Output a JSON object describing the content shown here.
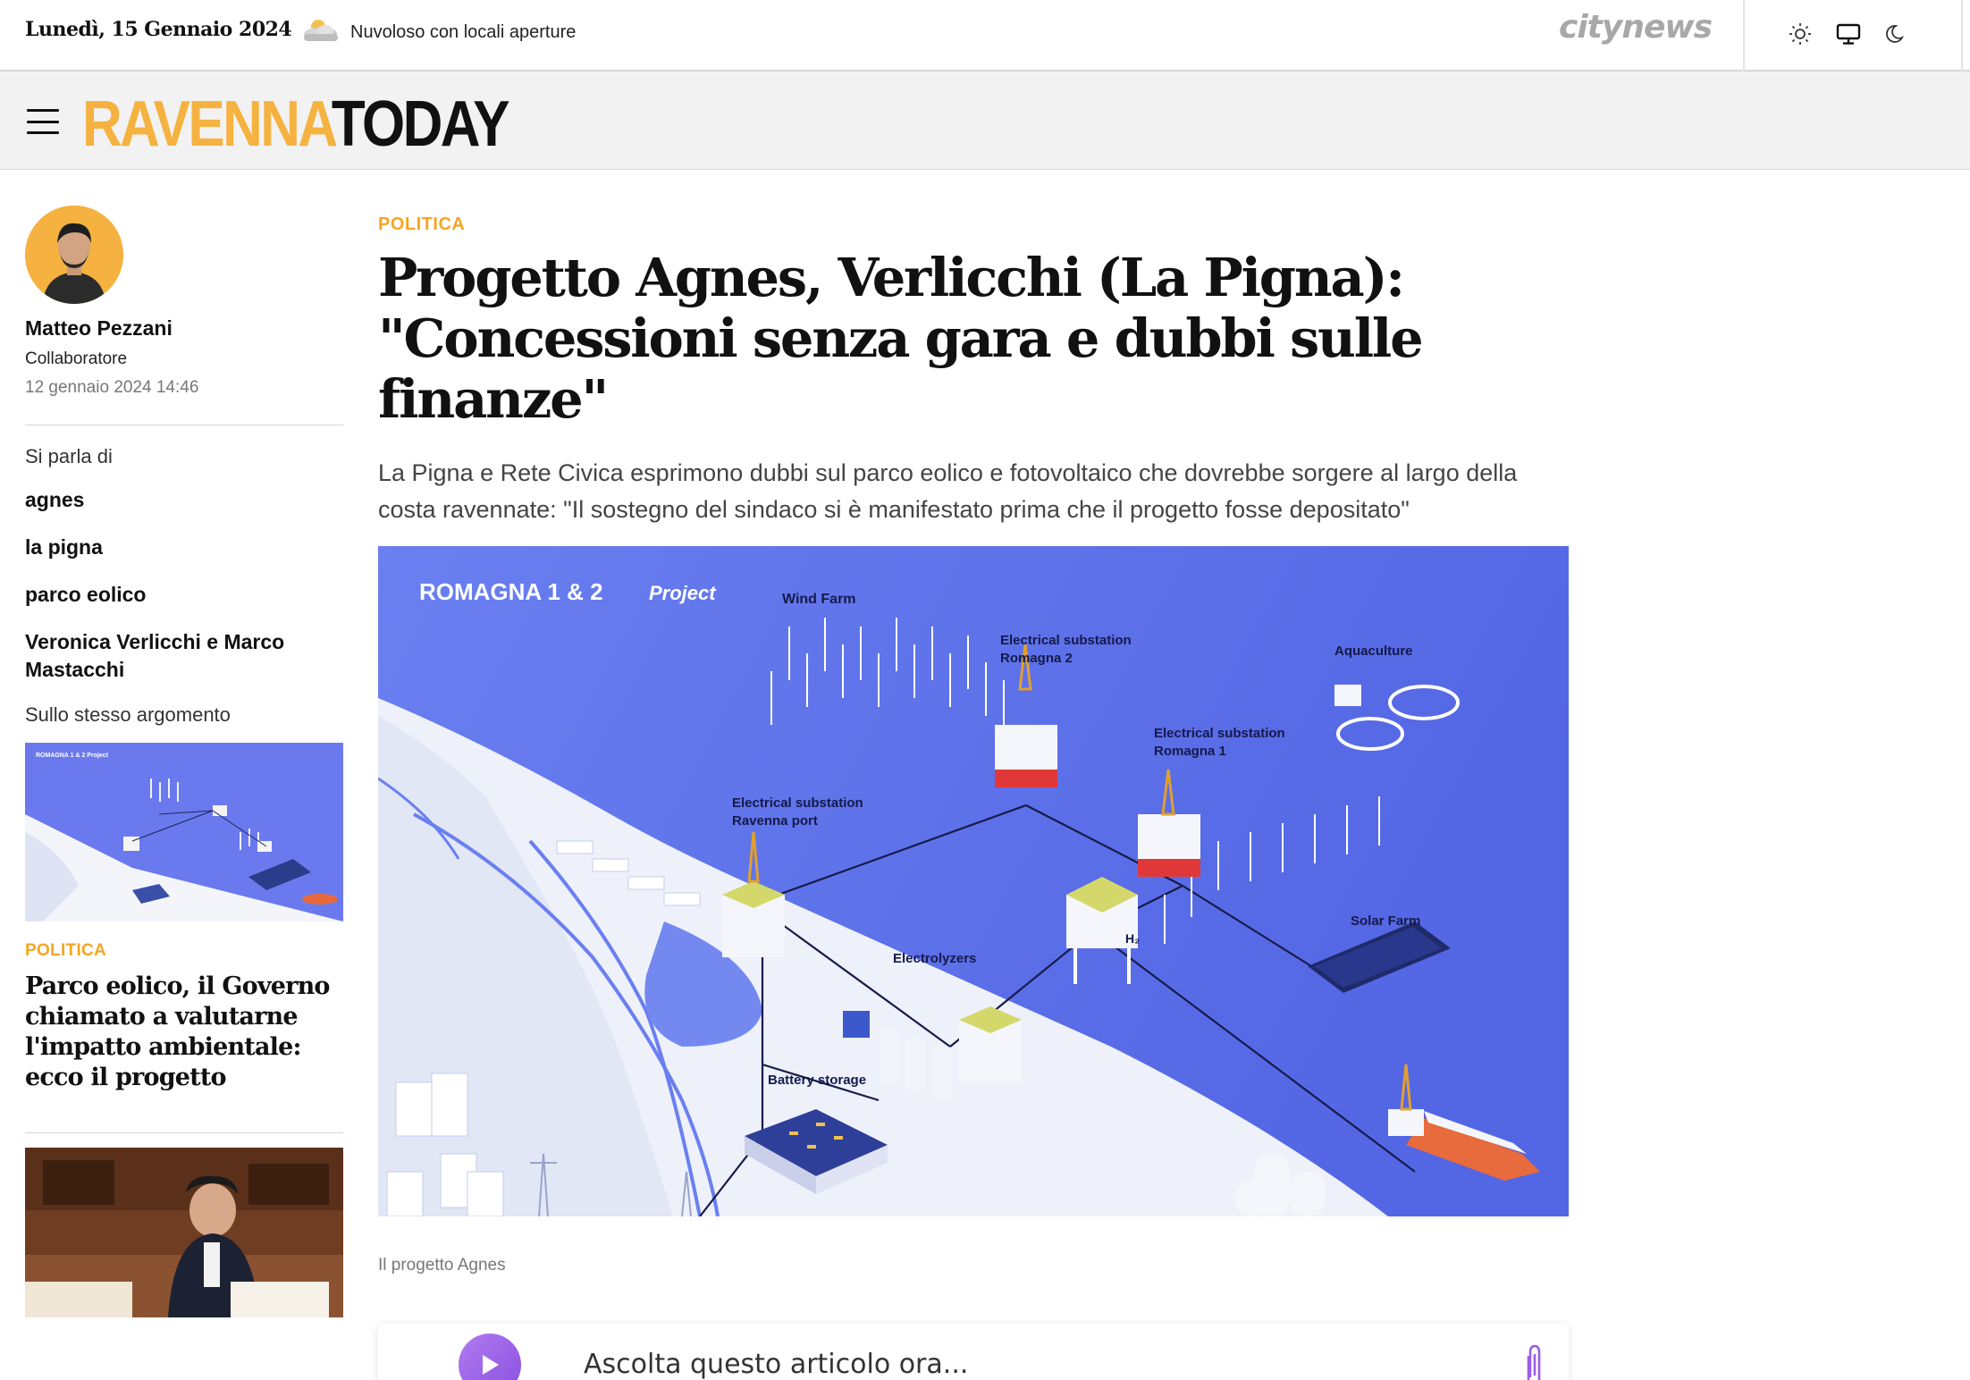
{
  "topbar": {
    "date": "Lunedì, 15 Gennaio 2024",
    "weather_icon": "cloudy-sun-icon",
    "weather": "Nuvoloso con locali aperture",
    "brand": "citynews",
    "modes": [
      "sun-icon",
      "monitor-icon",
      "moon-icon"
    ]
  },
  "header": {
    "logo_part1": "RAVENNA",
    "logo_part2": "TODAY",
    "accent_color": "#f5b240"
  },
  "author": {
    "name": "Matteo Pezzani",
    "role": "Collaboratore",
    "date": "12 gennaio 2024 14:46"
  },
  "tags": {
    "heading": "Si parla di",
    "items": [
      "agnes",
      "la pigna",
      "parco eolico",
      "Veronica Verlicchi e Marco Mastacchi"
    ]
  },
  "related": {
    "heading": "Sullo stesso argomento",
    "items": [
      {
        "category": "POLITICA",
        "title": "Parco eolico, il Governo chiamato a valutarne l'impatto ambientale: ecco il progetto"
      }
    ]
  },
  "article": {
    "category": "POLITICA",
    "headline": "Progetto Agnes, Verlicchi (La Pigna): \"Concessioni senza gara e dubbi sulle finanze\"",
    "lede": "La Pigna e Rete Civica esprimono dubbi sul parco eolico e fotovoltaico che dovrebbe sorgere al largo della costa ravennate: \"Il sostegno del sindaco si è manifestato prima che il progetto fosse depositato\"",
    "caption": "Il progetto Agnes",
    "figure": {
      "title_bold": "ROMAGNA 1 & 2",
      "title_italic": "Project",
      "labels": {
        "wind_farm": "Wind Farm",
        "sub_romagna2_l1": "Electrical substation",
        "sub_romagna2_l2": "Romagna 2",
        "aquaculture": "Aquaculture",
        "sub_romagna1_l1": "Electrical substation",
        "sub_romagna1_l2": "Romagna 1",
        "sub_ravenna_l1": "Electrical substation",
        "sub_ravenna_l2": "Ravenna port",
        "solar_farm": "Solar Farm",
        "electrolyzers": "Electrolyzers",
        "battery": "Battery storage",
        "h2": "H₂"
      }
    }
  },
  "audio": {
    "label": "Ascolta questo articolo ora...",
    "accent_color": "#9b5de5"
  }
}
